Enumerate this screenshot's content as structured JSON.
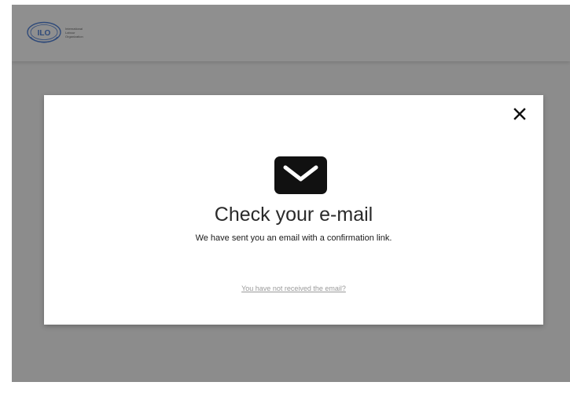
{
  "header": {
    "logo_icon": "ilo-emblem-icon",
    "logo_lines": [
      "International",
      "Labour",
      "Organization"
    ]
  },
  "modal": {
    "close_icon": "close-icon",
    "mail_icon": "envelope-icon",
    "title": "Check your e-mail",
    "message": "We have sent you an email with a confirmation link.",
    "resend_link": "You have not received the email?"
  },
  "colors": {
    "overlay": "#8c8c8c",
    "modal_bg": "#ffffff",
    "icon": "#111111",
    "link": "#9a9a9a"
  }
}
